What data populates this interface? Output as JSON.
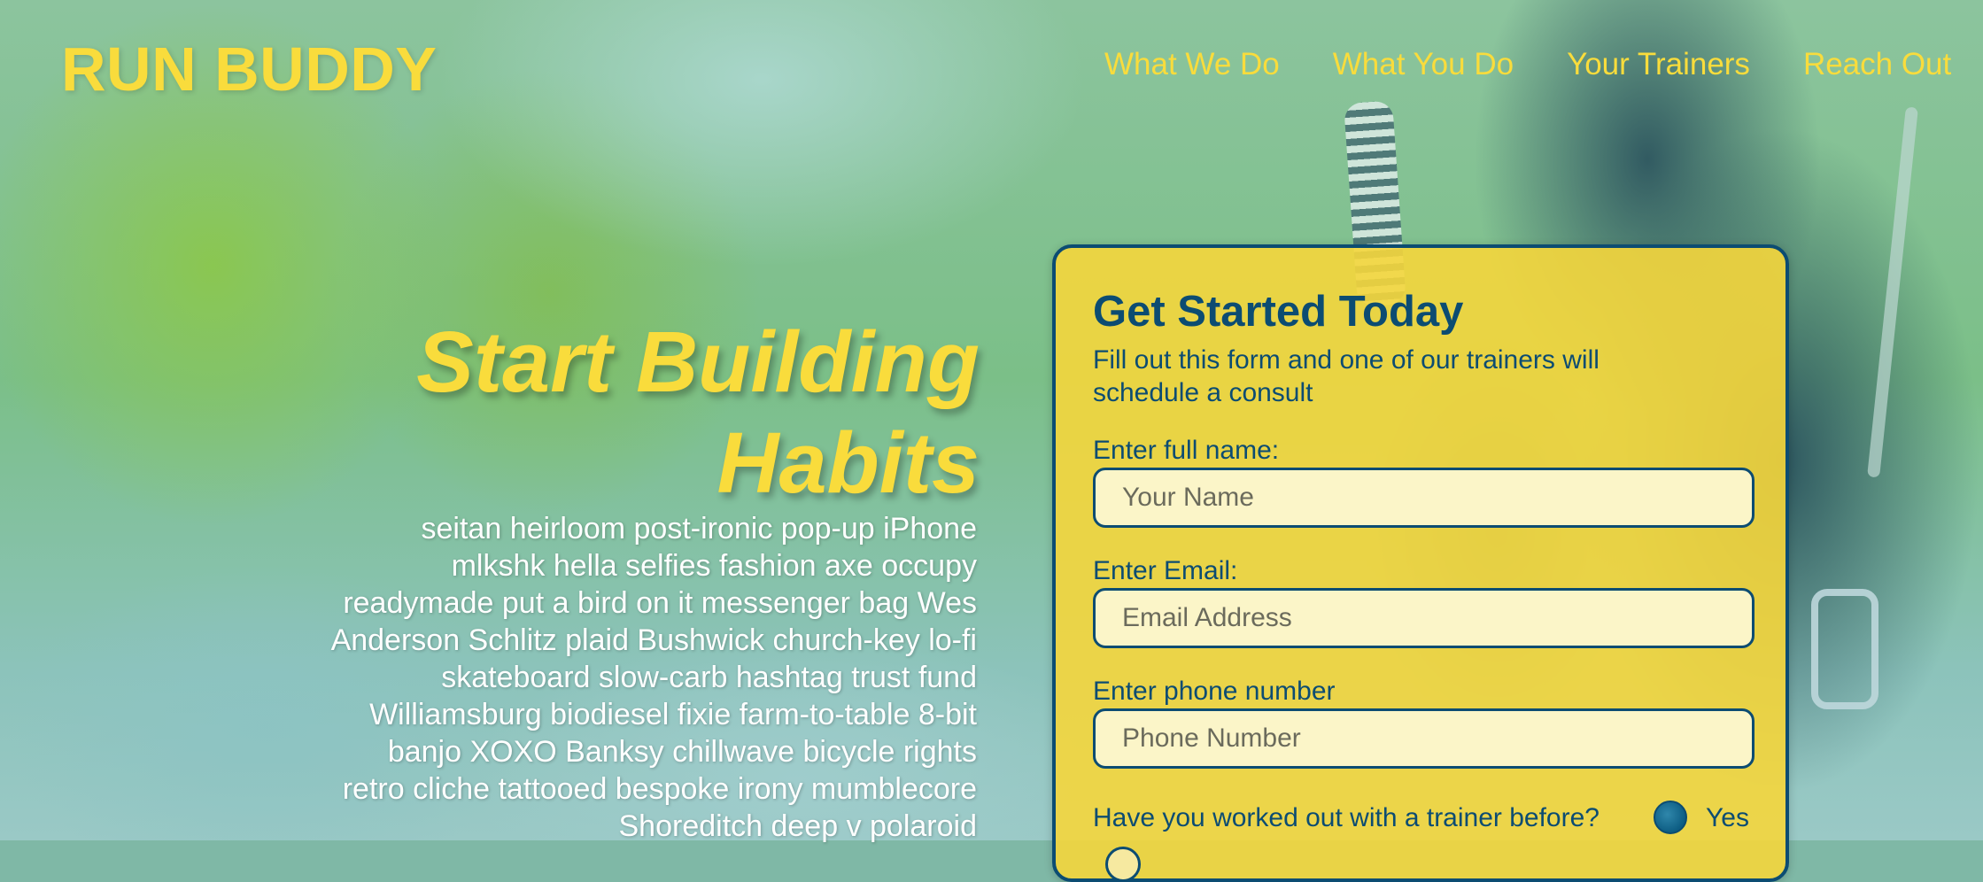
{
  "header": {
    "logo": "RUN BUDDY",
    "nav": [
      {
        "label": "What We Do"
      },
      {
        "label": "What You Do"
      },
      {
        "label": "Your Trainers"
      },
      {
        "label": "Reach Out"
      }
    ]
  },
  "hero": {
    "title_line1": "Start Building",
    "title_line2": "Habits",
    "body": "seitan heirloom post-ironic pop-up iPhone mlkshk hella selfies fashion axe occupy readymade put a bird on it messenger bag Wes Anderson Schlitz plaid Bushwick church-key lo-fi skateboard slow-carb hashtag trust fund Williamsburg biodiesel fixie farm-to-table 8-bit banjo XOXO Banksy chillwave bicycle rights retro cliche tattooed bespoke irony mumblecore Shoreditch deep v polaroid"
  },
  "form": {
    "title": "Get Started Today",
    "intro": "Fill out this form and one of our trainers will schedule a consult",
    "fields": [
      {
        "label": "Enter full name:",
        "placeholder": "Your Name"
      },
      {
        "label": "Enter Email:",
        "placeholder": "Email Address"
      },
      {
        "label": "Enter phone number",
        "placeholder": "Phone Number"
      }
    ],
    "question": "Have you worked out with a trainer before?",
    "radio_yes_label": "Yes"
  },
  "colors": {
    "accent_yellow": "#f9dc3c",
    "navy": "#0c4c72",
    "card_bg": "#f5d63c",
    "input_bg": "#fbf5c8"
  }
}
